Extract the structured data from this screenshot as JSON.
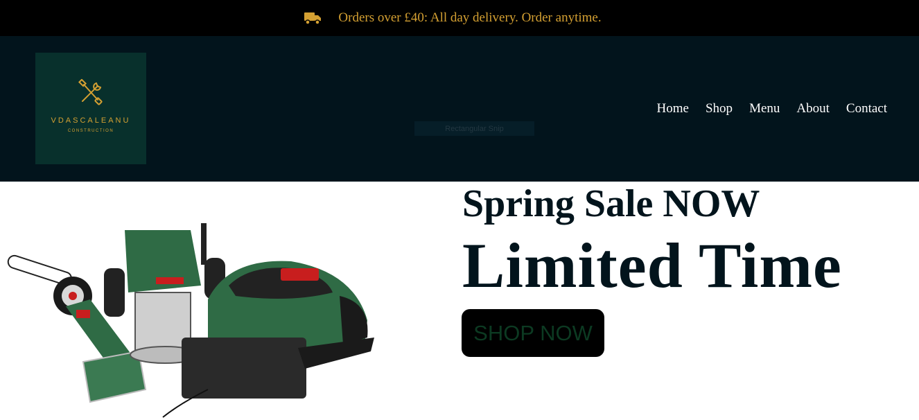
{
  "announcement": {
    "icon": "truck-icon",
    "text": "Orders over £40: All day delivery. Order anytime."
  },
  "logo": {
    "icon": "crossed-tools-icon",
    "brand": "VDASCALEANU",
    "subtitle": "CONSTRUCTION"
  },
  "tooltip": {
    "text": "Rectangular Snip"
  },
  "nav": {
    "items": [
      "Home",
      "Shop",
      "Menu",
      "About",
      "Contact"
    ]
  },
  "hero": {
    "headline": "Spring Sale NOW",
    "subheadline": "Limited Time",
    "cta_label": "SHOP NOW",
    "image": "power-tools-product-image"
  },
  "colors": {
    "topbar_bg": "#000000",
    "header_bg": "#02141c",
    "logo_bg": "#08302c",
    "accent_gold": "#d4a032",
    "tool_green": "#2f6b45",
    "cta_text": "#0c3a22"
  }
}
